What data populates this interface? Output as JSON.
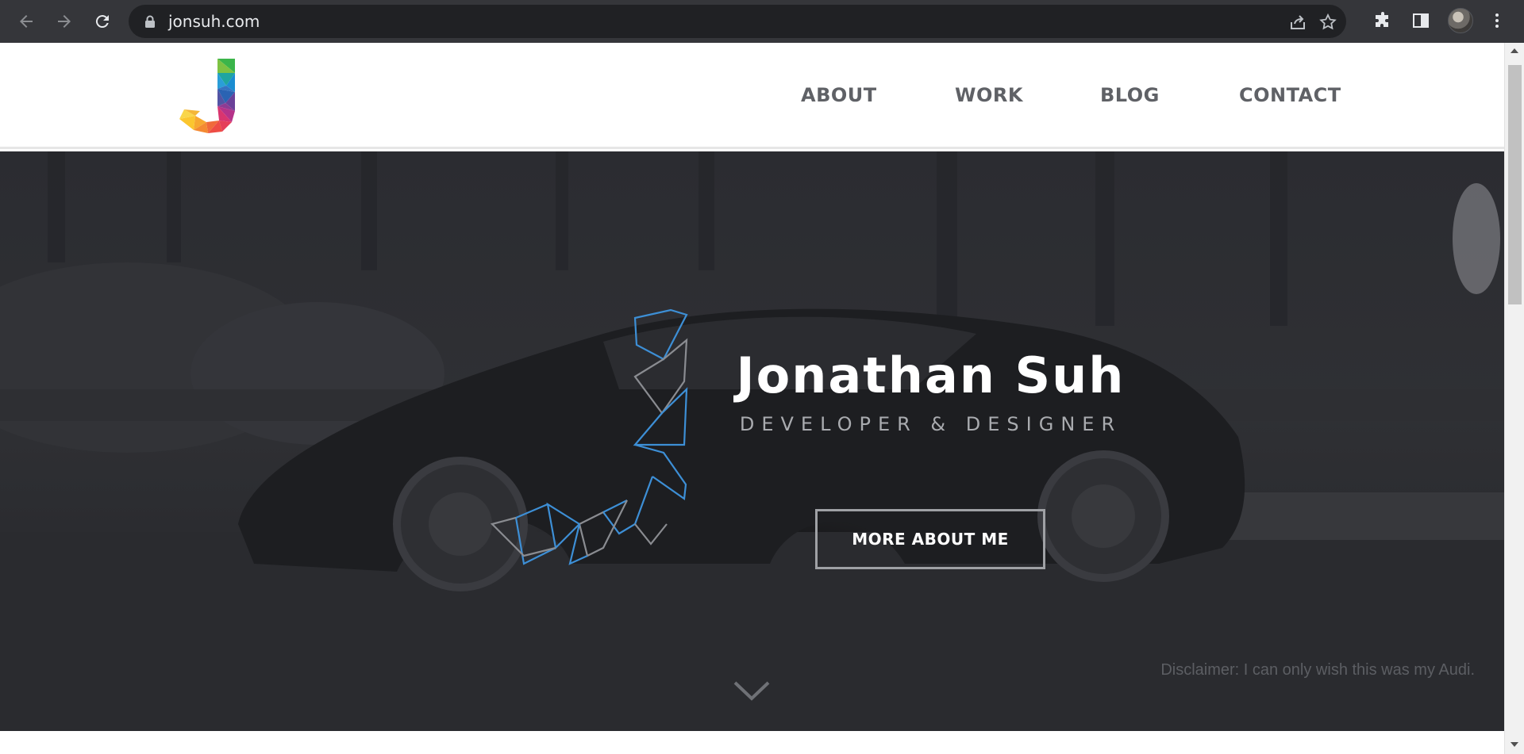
{
  "browser": {
    "url": "jonsuh.com",
    "icons": {
      "back": "arrow-left-icon",
      "forward": "arrow-right-icon",
      "reload": "reload-icon",
      "lock": "lock-icon",
      "share": "share-icon",
      "bookmark": "star-icon",
      "extensions": "puzzle-icon",
      "side_panel": "side-panel-icon",
      "profile": "avatar",
      "menu": "kebab-menu-icon"
    }
  },
  "site": {
    "logo": "J",
    "nav": [
      {
        "label": "ABOUT"
      },
      {
        "label": "WORK"
      },
      {
        "label": "BLOG"
      },
      {
        "label": "CONTACT"
      }
    ]
  },
  "hero": {
    "title": "Jonathan Suh",
    "subtitle": "DEVELOPER & DESIGNER",
    "button_label": "MORE ABOUT ME",
    "disclaimer": "Disclaimer: I can only wish this was my Audi.",
    "scroll_icon": "chevron-down-icon"
  },
  "colors": {
    "chrome_bg": "#35363a",
    "omnibox_bg": "#202124",
    "nav_text": "#5f6166",
    "hero_bg": "#2c2d31",
    "accent_blue": "#3d8fd6"
  }
}
